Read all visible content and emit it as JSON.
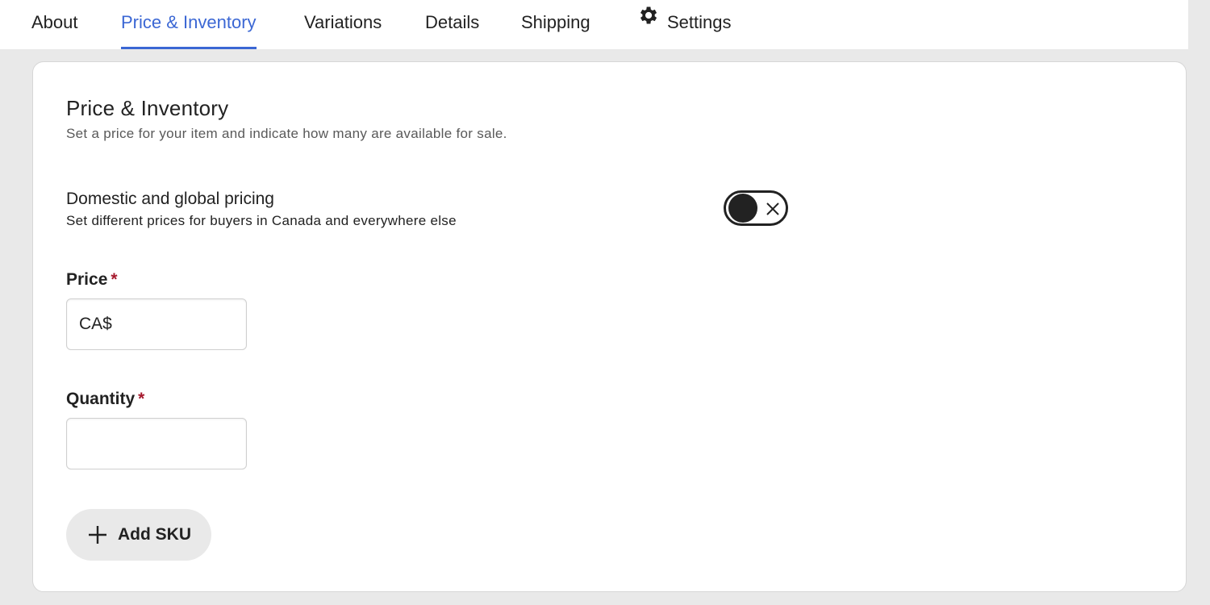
{
  "tabs": [
    {
      "label": "About",
      "active": false
    },
    {
      "label": "Price & Inventory",
      "active": true
    },
    {
      "label": "Variations",
      "active": false
    },
    {
      "label": "Details",
      "active": false
    },
    {
      "label": "Shipping",
      "active": false
    },
    {
      "label": "Settings",
      "active": false,
      "icon": "gear-icon"
    }
  ],
  "section": {
    "title": "Price & Inventory",
    "subtitle": "Set a price for your item and indicate how many are available for sale."
  },
  "pricing_toggle": {
    "title": "Domestic and global pricing",
    "subtitle": "Set different prices for buyers in Canada and everywhere else",
    "enabled": false
  },
  "price": {
    "label": "Price",
    "required_marker": "*",
    "prefix": "CA$",
    "value": ""
  },
  "quantity": {
    "label": "Quantity",
    "required_marker": "*",
    "value": ""
  },
  "add_sku": {
    "label": "Add SKU",
    "icon": "plus-icon"
  },
  "colors": {
    "accent": "#3b67d4",
    "required": "#a61a2e",
    "background": "#e9e9e9"
  }
}
